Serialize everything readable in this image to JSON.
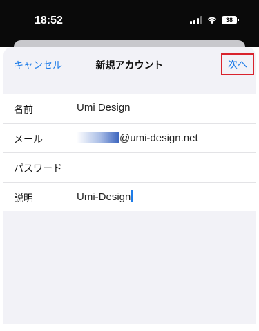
{
  "status_bar": {
    "time": "18:52",
    "battery": "38"
  },
  "nav": {
    "cancel_label": "キャンセル",
    "title": "新規アカウント",
    "next_label": "次へ"
  },
  "form": {
    "name_label": "名前",
    "name_value": "Umi Design",
    "email_label": "メール",
    "email_domain": "@umi-design.net",
    "password_label": "パスワード",
    "password_value": "",
    "description_label": "説明",
    "description_value": "Umi-Design"
  },
  "colors": {
    "accent": "#1e7ce8",
    "highlight_box": "#d9232d"
  }
}
